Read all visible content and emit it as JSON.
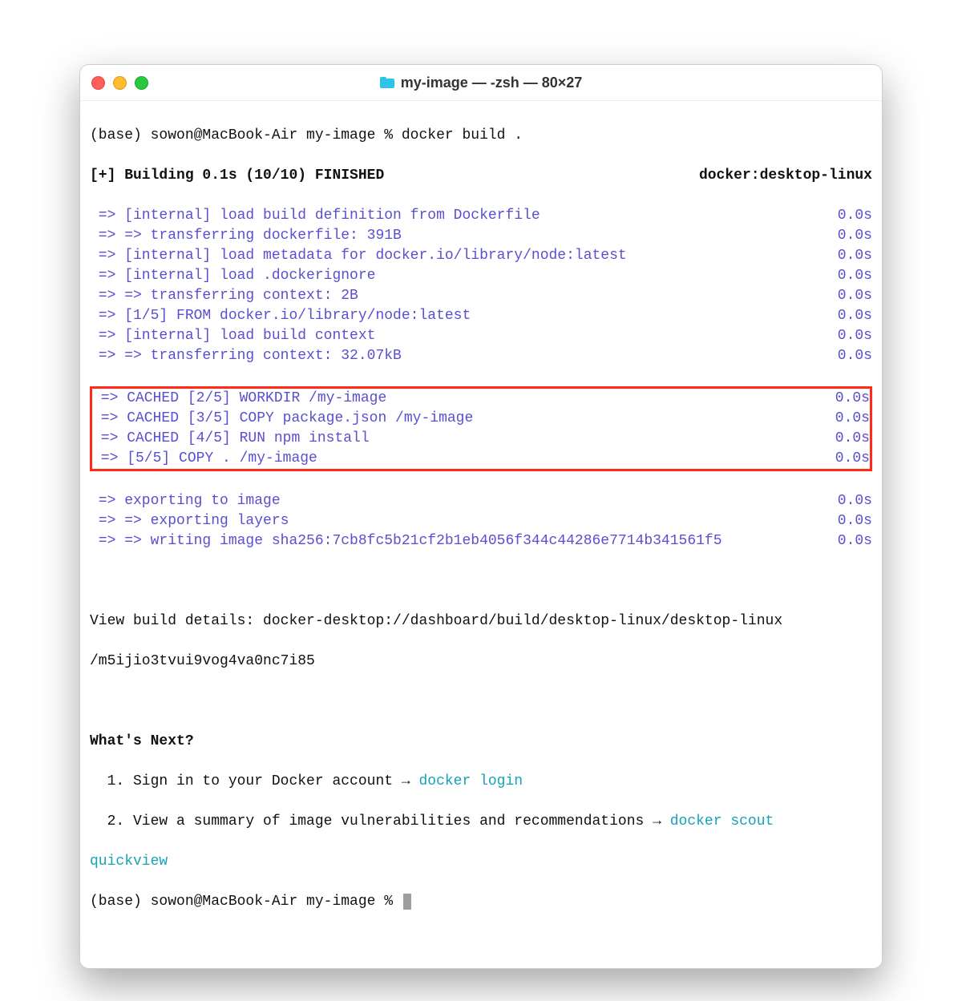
{
  "window": {
    "title": "my-image — -zsh — 80×27"
  },
  "prompt1": "(base) sowon@MacBook-Air my-image % docker build .",
  "buildStatus": {
    "left": "[+] Building 0.1s (10/10) FINISHED",
    "right": "docker:desktop-linux"
  },
  "lines": [
    {
      "text": " => [internal] load build definition from Dockerfile",
      "time": "0.0s"
    },
    {
      "text": " => => transferring dockerfile: 391B",
      "time": "0.0s"
    },
    {
      "text": " => [internal] load metadata for docker.io/library/node:latest",
      "time": "0.0s"
    },
    {
      "text": " => [internal] load .dockerignore",
      "time": "0.0s"
    },
    {
      "text": " => => transferring context: 2B",
      "time": "0.0s"
    },
    {
      "text": " => [1/5] FROM docker.io/library/node:latest",
      "time": "0.0s"
    },
    {
      "text": " => [internal] load build context",
      "time": "0.0s"
    },
    {
      "text": " => => transferring context: 32.07kB",
      "time": "0.0s"
    }
  ],
  "highlighted": [
    {
      "text": " => CACHED [2/5] WORKDIR /my-image",
      "time": "0.0s"
    },
    {
      "text": " => CACHED [3/5] COPY package.json /my-image",
      "time": "0.0s"
    },
    {
      "text": " => CACHED [4/5] RUN npm install",
      "time": "0.0s"
    },
    {
      "text": " => [5/5] COPY . /my-image",
      "time": "0.0s"
    }
  ],
  "linesAfter": [
    {
      "text": " => exporting to image",
      "time": "0.0s"
    },
    {
      "text": " => => exporting layers",
      "time": "0.0s"
    },
    {
      "text": " => => writing image sha256:7cb8fc5b21cf2b1eb4056f344c44286e7714b341561f5",
      "time": "0.0s"
    }
  ],
  "viewDetails1": "View build details: docker-desktop://dashboard/build/desktop-linux/desktop-linux",
  "viewDetails2": "/m5ijio3tvui9vog4va0nc7i85",
  "whatsNext": "What's Next?",
  "next1_pre": "  1. Sign in to your Docker account → ",
  "next1_cmd": "docker login",
  "next2_pre": "  2. View a summary of image vulnerabilities and recommendations → ",
  "next2_cmd1": "docker scout ",
  "next2_cmd2": "quickview",
  "prompt2": "(base) sowon@MacBook-Air my-image % "
}
